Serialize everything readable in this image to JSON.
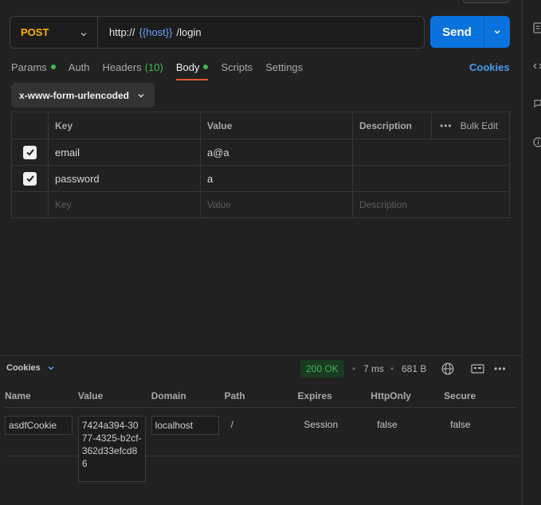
{
  "request": {
    "method": "POST",
    "url_prefix": "http://",
    "url_var": "{{host}}",
    "url_suffix": "/login",
    "send_label": "Send"
  },
  "tabs": {
    "params": "Params",
    "auth": "Auth",
    "headers": "Headers",
    "headers_count": "(10)",
    "body": "Body",
    "scripts": "Scripts",
    "settings": "Settings",
    "cookies": "Cookies"
  },
  "body_type": "x-www-form-urlencoded",
  "params_table": {
    "headers": {
      "key": "Key",
      "value": "Value",
      "description": "Description",
      "bulk": "Bulk Edit"
    },
    "rows": [
      {
        "key": "email",
        "value": "a@a",
        "checked": true
      },
      {
        "key": "password",
        "value": "a",
        "checked": true
      }
    ],
    "placeholders": {
      "key": "Key",
      "value": "Value",
      "description": "Description"
    }
  },
  "response": {
    "panel_title": "Cookies",
    "status": "200 OK",
    "time": "7 ms",
    "size": "681 B",
    "cookie_headers": [
      "Name",
      "Value",
      "Domain",
      "Path",
      "Expires",
      "HttpOnly",
      "Secure"
    ],
    "cookie": {
      "name": "asdfCookie",
      "value": "7424a394-3077-4325-b2cf-362d33efcd86",
      "domain": "localhost",
      "path": "/",
      "expires": "Session",
      "httponly": "false",
      "secure": "false"
    }
  },
  "colors": {
    "send": "#0a72dc",
    "method": "#ffb400",
    "status_ok": "#3fb950",
    "active_tab": "#e4572e"
  }
}
